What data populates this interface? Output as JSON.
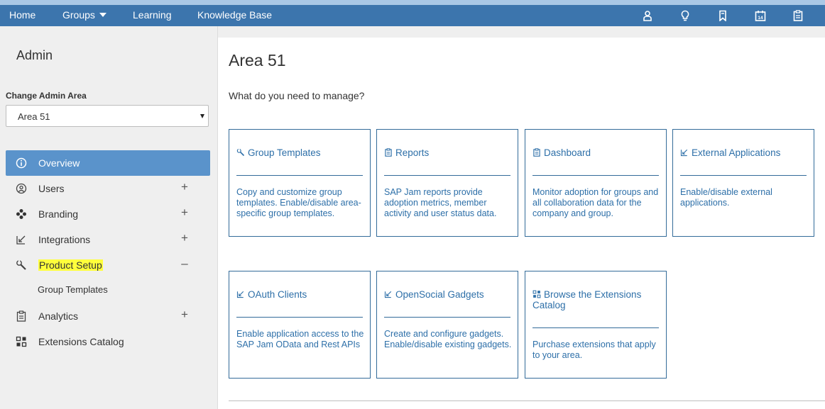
{
  "nav": {
    "home": "Home",
    "groups": "Groups",
    "learning": "Learning",
    "knowledge_base": "Knowledge Base",
    "icons": [
      "person-icon",
      "lightbulb-icon",
      "bookmark-icon",
      "calendar-icon",
      "clipboard-icon"
    ],
    "calendar_day": "14"
  },
  "sidebar": {
    "title": "Admin",
    "change_label": "Change Admin Area",
    "selected_area": "Area 51",
    "items": [
      {
        "label": "Overview",
        "icon": "info-icon",
        "toggle": ""
      },
      {
        "label": "Users",
        "icon": "user-circle-icon",
        "toggle": "+"
      },
      {
        "label": "Branding",
        "icon": "palette-icon",
        "toggle": "+"
      },
      {
        "label": "Integrations",
        "icon": "integration-icon",
        "toggle": "+"
      },
      {
        "label": "Product Setup",
        "icon": "wrench-icon",
        "toggle": "–"
      },
      {
        "label": "Analytics",
        "icon": "clipboard-icon",
        "toggle": "+"
      },
      {
        "label": "Extensions Catalog",
        "icon": "extensions-icon",
        "toggle": ""
      }
    ],
    "sub_items": [
      "Group Templates"
    ]
  },
  "main": {
    "title": "Area 51",
    "question": "What do you need to manage?",
    "cards": [
      {
        "title": "Group Templates",
        "icon": "wrench-icon",
        "desc": "Copy and customize group templates. Enable/disable area-specific group templates."
      },
      {
        "title": "Reports",
        "icon": "clipboard-icon",
        "desc": "SAP Jam reports provide adoption metrics, member activity and user status data."
      },
      {
        "title": "Dashboard",
        "icon": "clipboard-icon",
        "desc": "Monitor adoption for groups and all collaboration data for the company and group."
      },
      {
        "title": "External Applications",
        "icon": "integration-icon",
        "desc": "Enable/disable external applications."
      },
      {
        "title": "OAuth Clients",
        "icon": "integration-icon",
        "desc": "Enable application access to the SAP Jam OData and Rest APIs"
      },
      {
        "title": "OpenSocial Gadgets",
        "icon": "integration-icon",
        "desc": "Create and configure gadgets. Enable/disable existing gadgets."
      },
      {
        "title": "Browse the Extensions Catalog",
        "icon": "extensions-icon",
        "desc": "Purchase extensions that apply to your area."
      }
    ]
  },
  "colors": {
    "nav_bg": "#3c75ad",
    "active_item": "#5a93cb",
    "card_text": "#2d6fa8",
    "highlight": "#ffff3c"
  }
}
